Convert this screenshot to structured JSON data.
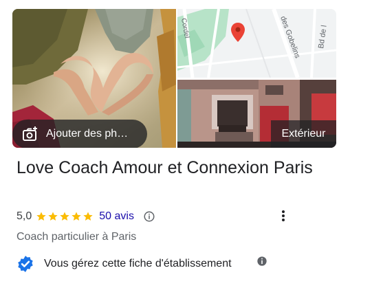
{
  "photos": {
    "add_photos_label": "Ajouter des ph…",
    "exterior_label": "Extérieur",
    "map": {
      "street_labels": [
        "Cordel",
        "des Gobelins",
        "Bd de l"
      ],
      "pin_color": "#ea4335"
    }
  },
  "business": {
    "name": "Love Coach Amour et Connexion Paris",
    "rating": "5,0",
    "stars": 5,
    "reviews_label": "50 avis",
    "category": "Coach particulier à Paris",
    "verified_text": "Vous gérez cette fiche d'établissement"
  },
  "colors": {
    "star": "#fbbc04",
    "link": "#1a0dab",
    "verified_badge": "#1a73e8",
    "secondary_text": "#5f6368"
  },
  "icons": {
    "add_photo": "add-photo-camera-icon",
    "info": "info-icon",
    "more": "more-vertical-icon",
    "verified": "verified-badge-icon"
  }
}
